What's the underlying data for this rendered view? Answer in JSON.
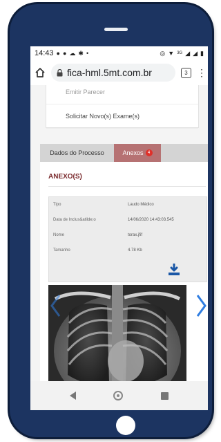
{
  "status_bar": {
    "time": "14:43",
    "left_icons": [
      "notification-icon",
      "notification-icon",
      "cloud-icon",
      "gear-icon",
      "dot-icon"
    ],
    "right_icons": [
      "alarm-icon",
      "wifi-icon",
      "signal-icon",
      "battery-icon"
    ],
    "network_label": "3G"
  },
  "browser": {
    "url": "fica-hml.5mt.com.br",
    "tabs_count": "3"
  },
  "menu": {
    "items": [
      "Emitir Parecer",
      "Solicitar Novo(s) Exame(s)"
    ]
  },
  "tabs": [
    {
      "label": "Dados do Processo"
    },
    {
      "label": "Anexos",
      "badge": "4"
    }
  ],
  "anexos": {
    "title": "ANEXO(S)",
    "fields": [
      {
        "key": "Tipo",
        "value": "Laudo Médico"
      },
      {
        "key": "Data de Inclus&atilde;o",
        "value": "14/06/2020 14:43:03.545"
      },
      {
        "key": "Nome",
        "value": "torax.jfif"
      },
      {
        "key": "Tamanho",
        "value": "4.78 Kb"
      }
    ],
    "download_icon": "download-icon",
    "accent_color": "#1a57a6"
  },
  "colors": {
    "phone_frame": "#1c3461",
    "active_tab": "#b67273",
    "title_color": "#7a2a2d",
    "badge": "#e0302a",
    "arrow": "#2f7de1"
  }
}
